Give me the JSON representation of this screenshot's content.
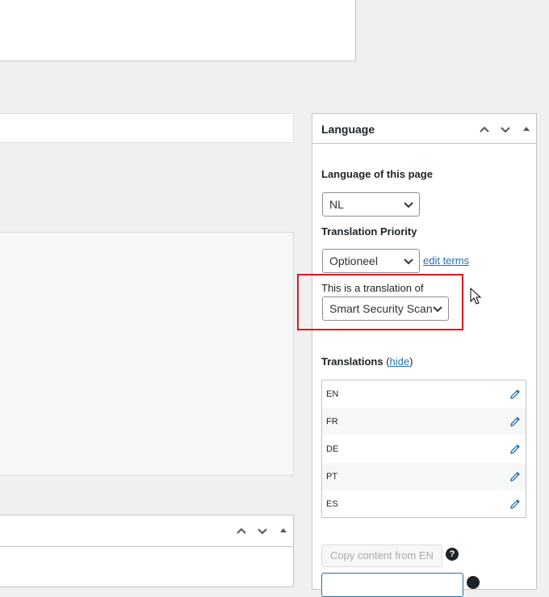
{
  "sidebar": {
    "title": "Language",
    "language_label": "Language of this page",
    "language_value": "NL",
    "priority_label": "Translation Priority",
    "priority_value": "Optioneel",
    "edit_terms": "edit terms",
    "translation_of_label": "This is a translation of",
    "translation_of_value": "Smart Security Scan",
    "translations_label": "Translations",
    "hide_link": "hide",
    "translations": [
      {
        "code": "EN"
      },
      {
        "code": "FR"
      },
      {
        "code": "DE"
      },
      {
        "code": "PT"
      },
      {
        "code": "ES"
      }
    ],
    "copy_button": "Copy content from EN",
    "help_glyph": "?"
  },
  "colors": {
    "accent": "#2271b1",
    "highlight": "#e0161f",
    "background": "#f0f0f1"
  },
  "icons": {
    "pencil": "pencil-icon",
    "chevron_up": "chevron-up-icon",
    "chevron_down": "chevron-down-icon",
    "toggle": "triangle-up-icon",
    "help": "help-icon"
  }
}
